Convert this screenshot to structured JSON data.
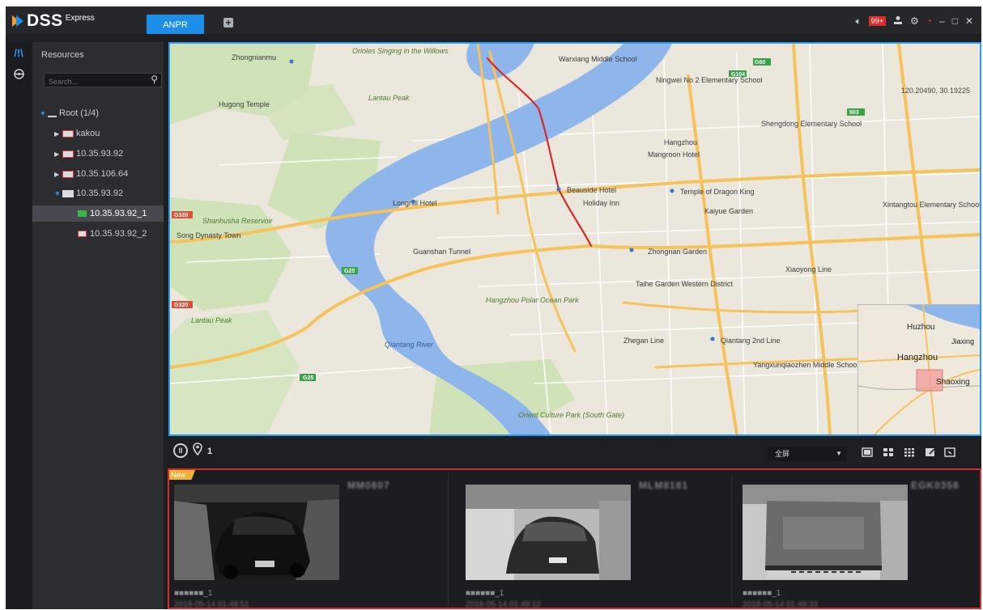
{
  "app": {
    "logo_name": "DSS",
    "logo_sub": "Express",
    "active_tab": "ANPR",
    "add_tab_glyph": "+",
    "alarm_badge": "99+"
  },
  "icons": {
    "rail": [
      "resources-icon",
      "vehicle-icon"
    ],
    "titlebar": [
      "speaker-icon",
      "user-icon",
      "gear-icon",
      "power-icon",
      "minimize-icon",
      "maximize-icon",
      "close-icon"
    ],
    "map_toolbar": [
      "pause-icon",
      "location-pin-icon",
      "single-view-icon",
      "grid-4-icon",
      "grid-9-icon",
      "edit-icon",
      "fullscreen-icon"
    ]
  },
  "panel": {
    "title": "Resources",
    "search_placeholder": "Search...",
    "tree": [
      {
        "label": "Root (1/4)",
        "level": 0,
        "expanded": true,
        "type": "root"
      },
      {
        "label": "kakou",
        "level": 1,
        "expanded": false,
        "type": "device-offline"
      },
      {
        "label": "10.35.93.92",
        "level": 1,
        "expanded": false,
        "type": "device-offline"
      },
      {
        "label": "10.35.106.64",
        "level": 1,
        "expanded": false,
        "type": "device-offline"
      },
      {
        "label": "10.35.93.92",
        "level": 1,
        "expanded": true,
        "type": "device-online"
      },
      {
        "label": "10.35.93.92_1",
        "level": 2,
        "type": "camera-online",
        "selected": true
      },
      {
        "label": "10.35.93.92_2",
        "level": 2,
        "type": "camera-offline"
      }
    ]
  },
  "map": {
    "coordinates": "120.20490, 30.19225",
    "labels": {
      "willows": "Orioles Singing in the Willows",
      "warxiang": "Warxiang Middle School",
      "ningwei": "Ningwei No 2 Elementary School",
      "zhongnianmu": "Zhongnianmu",
      "hugong": "Hugong Temple",
      "lantau": "Lantau Peak",
      "shengdong": "Shengdong Elementary School",
      "hangzhou": "Hangzhou",
      "mangroon": "Mangroon Hotel",
      "beauside": "Beauside Hotel",
      "dragon_king": "Temple of Dragon King",
      "holiday_inn": "Holiday Inn",
      "longhill": "Longhill Hotel",
      "reservoir": "Shanhusha Reservoir",
      "song_dynasty": "Song Dynasty Town",
      "guanshan": "Guanshan Tunnel",
      "zhongnan": "Zhongnan Garden",
      "kaiyue": "Kaiyue Garden",
      "xintangtou": "Xintangtou Elementary School",
      "xiaoyong": "Xiaoyong Line",
      "taihe": "Taihe Garden Western District",
      "ocean_park": "Hangzhou Polar Ocean Park",
      "qiantang_river": "Qiantang River",
      "qiantang_2nd": "Qiantang 2nd Line",
      "zhegan": "Zhegan Line",
      "yangxunqiao": "Yangxunqiaozhen Middle School",
      "lantau2": "Lantau Peak",
      "orient": "Orient Culture Park (South Gate)",
      "huzhou": "Huzhou",
      "jiaxing": "Jiaxing",
      "hangzhou_ov": "Hangzhou",
      "shaoxing": "Shaoxing",
      "sign_g104": "G104",
      "sign_g320": "G320",
      "sign_g25": "G25",
      "sign_s03": "503",
      "sign_g60": "G60"
    }
  },
  "map_toolbar": {
    "pause_glyph": "II",
    "count": "1",
    "view_select": "全屏"
  },
  "snapshots": [
    {
      "new": "New",
      "plate": "MM0807",
      "name": "■■■■■■_1",
      "time": "2018-05-14 01:48:51"
    },
    {
      "new": "",
      "plate": "MLM8181",
      "name": "■■■■■■_1",
      "time": "2018-05-14 01:49:12"
    },
    {
      "new": "",
      "plate": "EGK0358",
      "name": "■■■■■■_1",
      "time": "2018-05-14 01:49:33"
    }
  ]
}
